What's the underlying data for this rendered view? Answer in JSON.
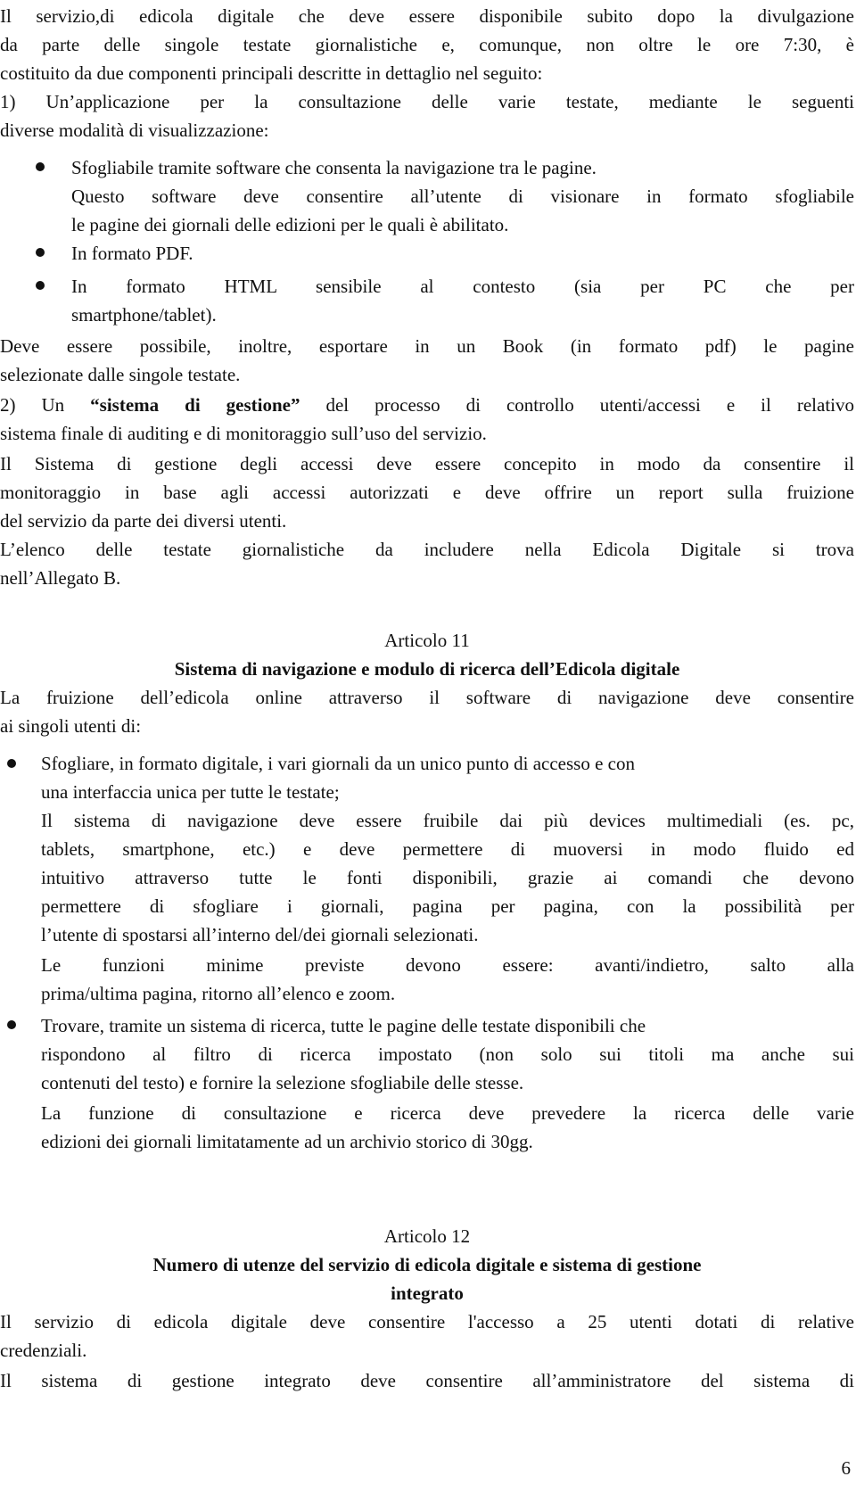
{
  "document": {
    "intro": {
      "lines": [
        "Il servizio,di edicola digitale che deve essere disponibile subito dopo la divulgazione",
        "da parte delle singole testate giornalistiche e, comunque, non oltre le ore 7:30, è",
        "costituito da due componenti principali descritte in dettaglio nel seguito:",
        "1) Un’applicazione per la consultazione delle varie testate, mediante le seguenti",
        "diverse modalità di visualizzazione:"
      ]
    },
    "modes_list": [
      {
        "lines": [
          "Sfogliabile tramite software che consenta la navigazione tra le pagine.",
          "Questo software deve consentire all’utente di visionare in formato sfogliabile",
          "le pagine dei giornali delle edizioni per le quali è abilitato."
        ]
      },
      {
        "lines": [
          "In formato PDF."
        ]
      },
      {
        "lines": [
          "In formato HTML sensibile al contesto (sia per PC che per",
          "smartphone/tablet)."
        ]
      }
    ],
    "export_para": [
      "Deve essere possibile, inoltre, esportare in un Book (in formato pdf) le pagine",
      "selezionate dalle singole testate."
    ],
    "item2": {
      "prefix": "2) Un ",
      "bold": "“sistema di gestione”",
      "suffix": " del processo di controllo utenti/accessi e il relativo",
      "line2": "sistema finale di auditing e di monitoraggio sull’uso del servizio."
    },
    "access_para": [
      "Il Sistema di gestione degli accessi deve essere concepito in modo da consentire il",
      "monitoraggio in base agli accessi autorizzati e deve offrire un report sulla fruizione",
      "del servizio da parte dei diversi utenti."
    ],
    "allegato_para": [
      "L’elenco delle testate giornalistiche da includere nella Edicola Digitale si trova",
      "nell’Allegato B."
    ],
    "art11": {
      "number": "Articolo 11",
      "title": "Sistema di navigazione e modulo di ricerca dell’Edicola digitale",
      "intro": [
        "La fruizione dell’edicola online attraverso il software di navigazione deve consentire",
        "ai singoli utenti di:"
      ],
      "items": [
        {
          "lines": [
            "Sfogliare, in formato digitale, i vari giornali da un unico punto di accesso e con",
            "una interfaccia unica per tutte le testate;",
            "Il sistema di navigazione deve essere fruibile dai più devices multimediali (es. pc,",
            "tablets, smartphone, etc.) e deve permettere di muoversi in modo fluido ed",
            "intuitivo attraverso tutte le fonti disponibili, grazie ai comandi che devono",
            "permettere di sfogliare i giornali, pagina per pagina, con la possibilità per",
            "l’utente di spostarsi all’interno del/dei giornali selezionati.",
            "Le funzioni minime previste devono essere: avanti/indietro, salto alla",
            "prima/ultima pagina, ritorno all’elenco e zoom."
          ]
        },
        {
          "lines": [
            "Trovare, tramite un sistema di ricerca, tutte le pagine delle testate disponibili che",
            "rispondono al filtro di ricerca impostato (non solo sui titoli ma anche sui",
            "contenuti del testo) e fornire la selezione sfogliabile delle stesse.",
            "La funzione di consultazione e ricerca deve prevedere la ricerca delle varie",
            "edizioni dei giornali limitatamente ad un archivio storico di 30gg."
          ]
        }
      ]
    },
    "art12": {
      "number": "Articolo 12",
      "title_lines": [
        "Numero di utenze del servizio di edicola digitale e sistema di gestione",
        "integrato"
      ],
      "body": [
        "Il servizio di edicola digitale deve consentire l'accesso a 25 utenti dotati di relative",
        "credenziali.",
        "Il sistema di gestione integrato deve consentire all’amministratore del sistema di"
      ]
    },
    "page_number": "6"
  }
}
